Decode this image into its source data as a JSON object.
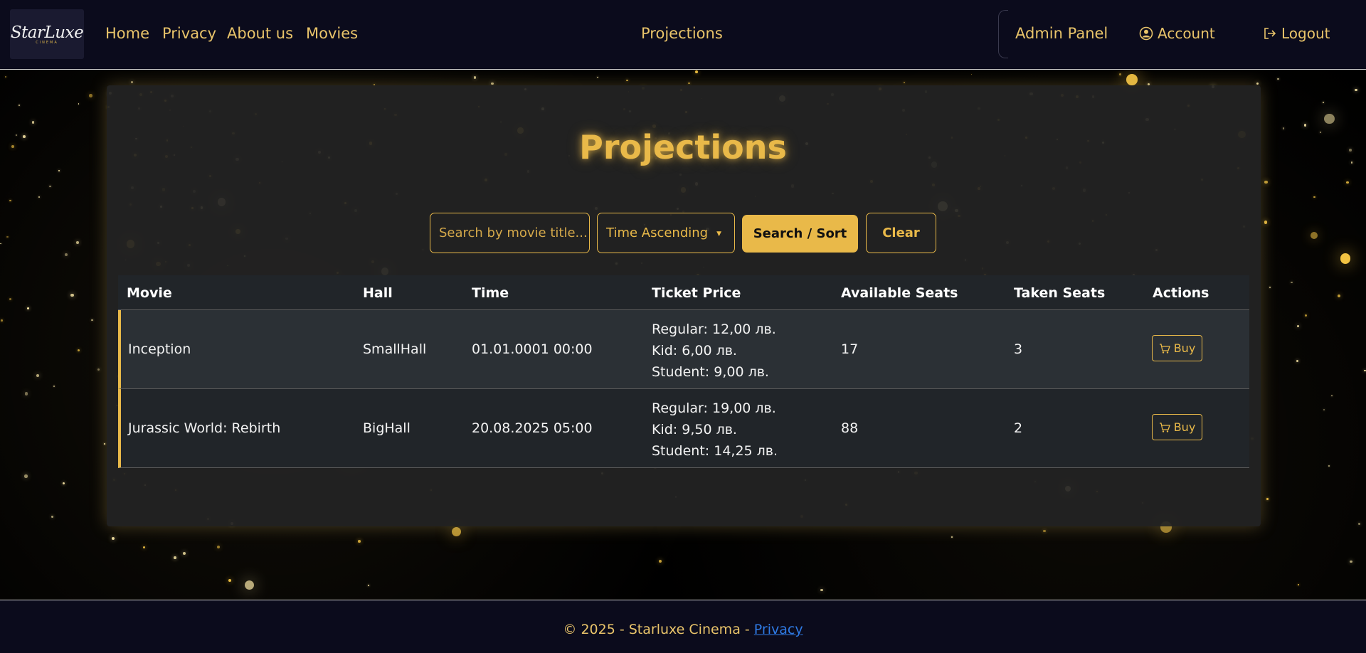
{
  "brand": {
    "logo_text": "StarLuxe",
    "logo_subtext": "CINEMA"
  },
  "nav": {
    "links": [
      "Home",
      "Privacy",
      "About us",
      "Movies"
    ],
    "center_link": "Projections",
    "admin": "Admin Panel",
    "account": "Account",
    "logout": "Logout"
  },
  "page": {
    "title": "Projections"
  },
  "filters": {
    "search_placeholder": "Search by movie title...",
    "sort_selected": "Time Ascending",
    "search_button": "Search / Sort",
    "clear_button": "Clear"
  },
  "table": {
    "headers": [
      "Movie",
      "Hall",
      "Time",
      "Ticket Price",
      "Available Seats",
      "Taken Seats",
      "Actions"
    ],
    "rows": [
      {
        "movie": "Inception",
        "hall": "SmallHall",
        "time": "01.01.0001 00:00",
        "price_regular": "Regular: 12,00 лв.",
        "price_kid": "Kid: 6,00 лв.",
        "price_student": "Student: 9,00 лв.",
        "available": "17",
        "taken": "3",
        "action": "Buy"
      },
      {
        "movie": "Jurassic World: Rebirth",
        "hall": "BigHall",
        "time": "20.08.2025 05:00",
        "price_regular": "Regular: 19,00 лв.",
        "price_kid": "Kid: 9,50 лв.",
        "price_student": "Student: 14,25 лв.",
        "available": "88",
        "taken": "2",
        "action": "Buy"
      }
    ]
  },
  "footer": {
    "text": "© 2025 - Starluxe Cinema -",
    "link": "Privacy"
  },
  "colors": {
    "accent": "#e9b949",
    "nav_bg": "#0b0b1c",
    "card_bg": "#242424",
    "link_blue": "#2f7be6"
  },
  "icons": [
    "account-icon",
    "logout-icon",
    "cart-icon",
    "caret-down-icon"
  ]
}
